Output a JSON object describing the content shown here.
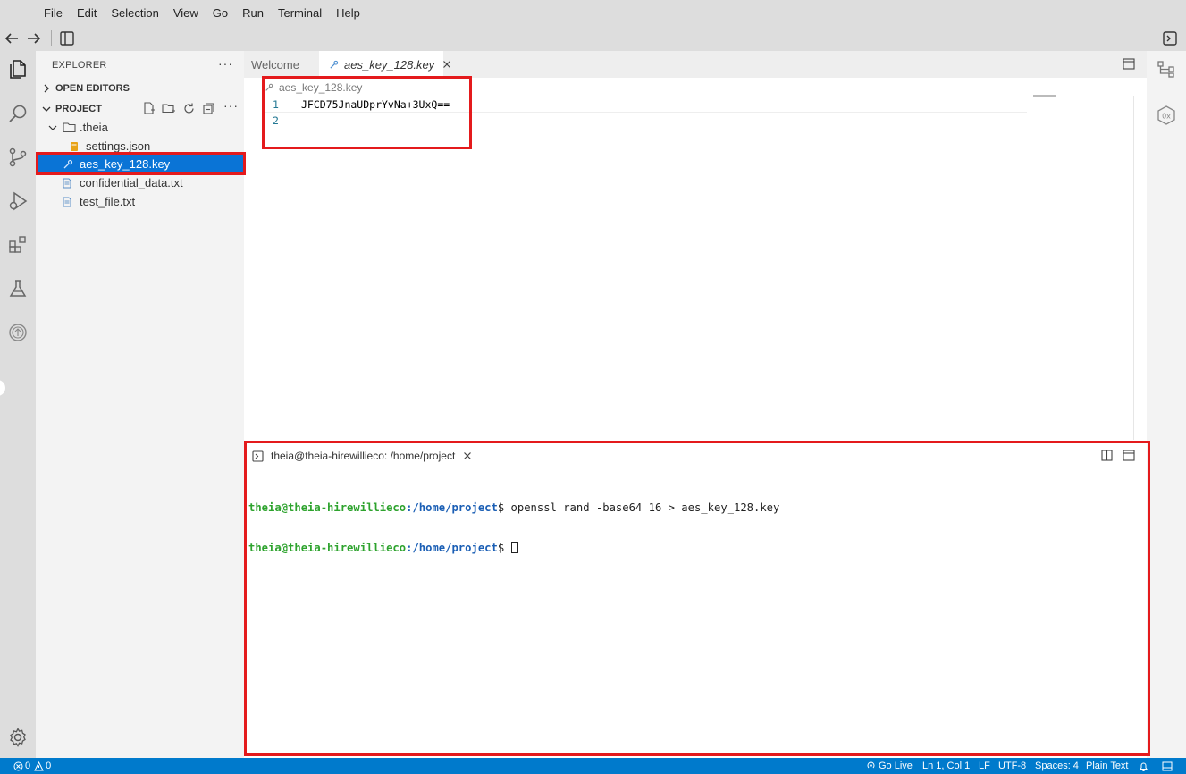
{
  "menu": [
    "File",
    "Edit",
    "Selection",
    "View",
    "Go",
    "Run",
    "Terminal",
    "Help"
  ],
  "explorer": {
    "title": "EXPLORER",
    "more": "···",
    "open_editors": "OPEN EDITORS",
    "project": "PROJECT",
    "tree": [
      {
        "label": ".theia",
        "type": "folder"
      },
      {
        "label": "settings.json",
        "type": "json"
      },
      {
        "label": "aes_key_128.key",
        "type": "key",
        "selected": true
      },
      {
        "label": "confidential_data.txt",
        "type": "text"
      },
      {
        "label": "test_file.txt",
        "type": "text"
      }
    ]
  },
  "tabs": [
    {
      "label": "Welcome",
      "active": false
    },
    {
      "label": "aes_key_128.key",
      "active": true
    }
  ],
  "editor": {
    "breadcrumb": "aes_key_128.key",
    "lines": [
      {
        "num": "1",
        "text": "JFCD75JnaUDprYvNa+3UxQ=="
      },
      {
        "num": "2",
        "text": ""
      }
    ]
  },
  "terminal": {
    "tab_label": "theia@theia-hirewillieco: /home/project",
    "lines": [
      {
        "user": "theia@theia-hirewillieco",
        "path": ":/home/project",
        "cmd": "$ openssl rand -base64 16 > aes_key_128.key"
      },
      {
        "user": "theia@theia-hirewillieco",
        "path": ":/home/project",
        "cmd": "$ "
      }
    ]
  },
  "status": {
    "errors": "0",
    "warnings": "0",
    "go_live": "Go Live",
    "position": "Ln 1, Col 1",
    "eol": "LF",
    "encoding": "UTF-8",
    "spaces": "Spaces: 4",
    "language": "Plain Text"
  },
  "colors": {
    "accent": "#007acc",
    "selection": "#0a74d6",
    "highlight": "#e41a1c",
    "terminal_user": "#2ea32e",
    "terminal_path": "#1b5fb5"
  }
}
